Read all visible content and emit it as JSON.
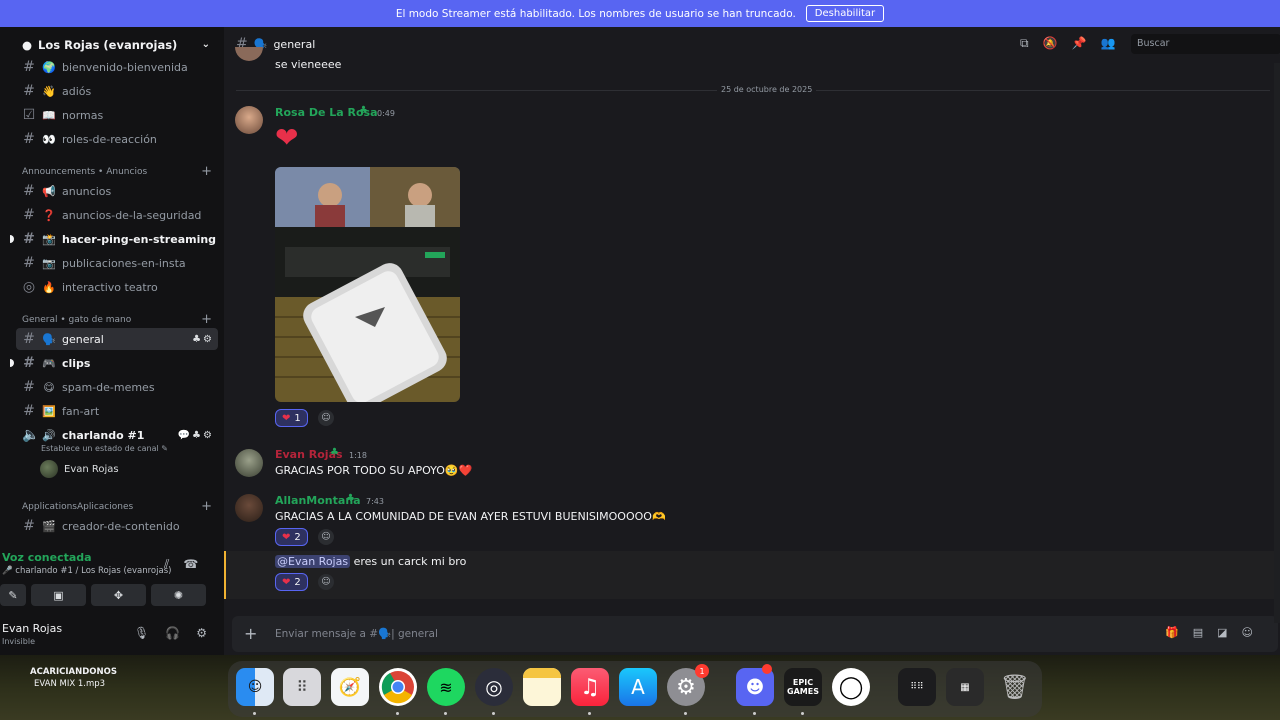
{
  "banner": {
    "text": "El modo Streamer está habilitado. Los nombres de usuario se han truncado.",
    "button": "Deshabilitar"
  },
  "server": {
    "name": "Los Rojas (evanrojas)"
  },
  "channels_top": [
    {
      "emoji": "🌍",
      "label": "bienvenido-bienvenida"
    },
    {
      "emoji": "👋",
      "label": "adiós"
    },
    {
      "emoji": "📖",
      "label": "normas"
    },
    {
      "emoji": "👀",
      "label": "roles-de-reacción"
    }
  ],
  "categories": {
    "announcements": "Announcements • Anuncios",
    "general": "General • gato de mano",
    "applications": "ApplicationsAplicaciones"
  },
  "channels_ann": [
    {
      "emoji": "📢",
      "label": "anuncios"
    },
    {
      "emoji": "❓",
      "label": "anuncios-de-la-seguridad"
    },
    {
      "emoji": "📸",
      "label": "hacer-ping-en-streaming"
    },
    {
      "emoji": "📷",
      "label": "publicaciones-en-insta"
    },
    {
      "emoji": "🔥",
      "label": "interactivo teatro"
    }
  ],
  "channels_gen": [
    {
      "emoji": "🗣️",
      "label": "general"
    },
    {
      "emoji": "🎮",
      "label": "clips"
    },
    {
      "emoji": "😋",
      "label": "spam-de-memes"
    },
    {
      "emoji": "🖼️",
      "label": "fan-art"
    },
    {
      "emoji": "🔊",
      "label": "charlando #1"
    }
  ],
  "voice_status": "Establece un estado de canal",
  "voice_member": "Evan Rojas",
  "channels_app": [
    {
      "emoji": "🎬",
      "label": "creador-de-contenido"
    }
  ],
  "voice_panel": {
    "title": "Voz conectada",
    "sub": "charlando #1 / Los Rojas (evanrojas)"
  },
  "user": {
    "name": "Evan Rojas",
    "status": "Invisible"
  },
  "topbar": {
    "channel": "general",
    "emoji": "🗣️",
    "search_placeholder": "Buscar"
  },
  "messages": {
    "prev_text": "se vieneeee",
    "date": "25 de octubre de 2025",
    "m1": {
      "user": "Rosa De La Rosa",
      "time": "0:49",
      "color": "#23a55a",
      "reaction_count": "1"
    },
    "m2": {
      "user": "Evan Rojas",
      "time": "1:18",
      "color": "#b4243a",
      "text": "GRACIAS POR TODO SU APOYO🥹❤️"
    },
    "m3": {
      "user": "AllanMontana",
      "time": "7:43",
      "color": "#23a55a",
      "text": "GRACIAS A LA COMUNIDAD DE EVAN AYER ESTUVI BUENISIMOOOOO🫶",
      "reaction_count": "2"
    },
    "m4": {
      "mention": "@Evan Rojas",
      "text": "eres un carck mi bro",
      "reaction_count": "2"
    }
  },
  "composer": {
    "placeholder": "Enviar mensaje a #🗣️| general"
  },
  "now_playing": {
    "title": "ACARICIANDONOS",
    "sub": "EVAN MIX 1.mp3"
  },
  "dock": {
    "settings_badge": "1",
    "epic_label": "EPIC GAMES"
  }
}
